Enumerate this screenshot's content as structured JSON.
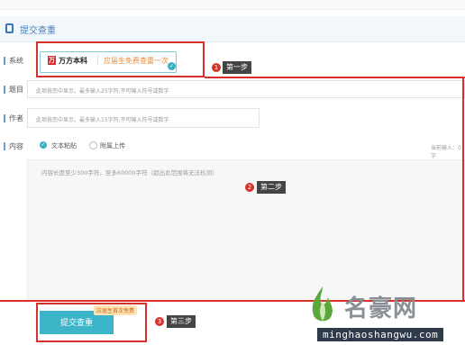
{
  "header": {
    "title": "提交查重"
  },
  "system_row": {
    "label": "系统",
    "brand_logo": "万",
    "brand_name": "万方本科",
    "promo": "应届生免费查重一次"
  },
  "title_row": {
    "label": "题目",
    "placeholder": "此项按您中显示，最多输入25字符,不可输入符号或数字"
  },
  "author_row": {
    "label": "作者",
    "placeholder": "此项按您中显示，最多输入15字符,不可输入符号或数字"
  },
  "content_row": {
    "label": "内容",
    "options": [
      "文本粘贴",
      "附属上传"
    ],
    "selected": "文本粘贴",
    "char_count": "当前输入：0字",
    "placeholder": "内容长度至少300字符，至多60000字符（超出此范围将无法检测）"
  },
  "submit": {
    "label": "提交查重",
    "tag": "应届生首次免费"
  },
  "annotations": [
    {
      "num": "1",
      "label": "第一步"
    },
    {
      "num": "2",
      "label": "第二步"
    },
    {
      "num": "3",
      "label": "第三步"
    }
  ],
  "watermark": {
    "brand": "名豪网",
    "url": "minghaoshangwu.com"
  },
  "colors": {
    "accent": "#3db5c8",
    "annotation": "#d6322b",
    "brand_red": "#d7282f",
    "promo": "#e88a3a"
  }
}
